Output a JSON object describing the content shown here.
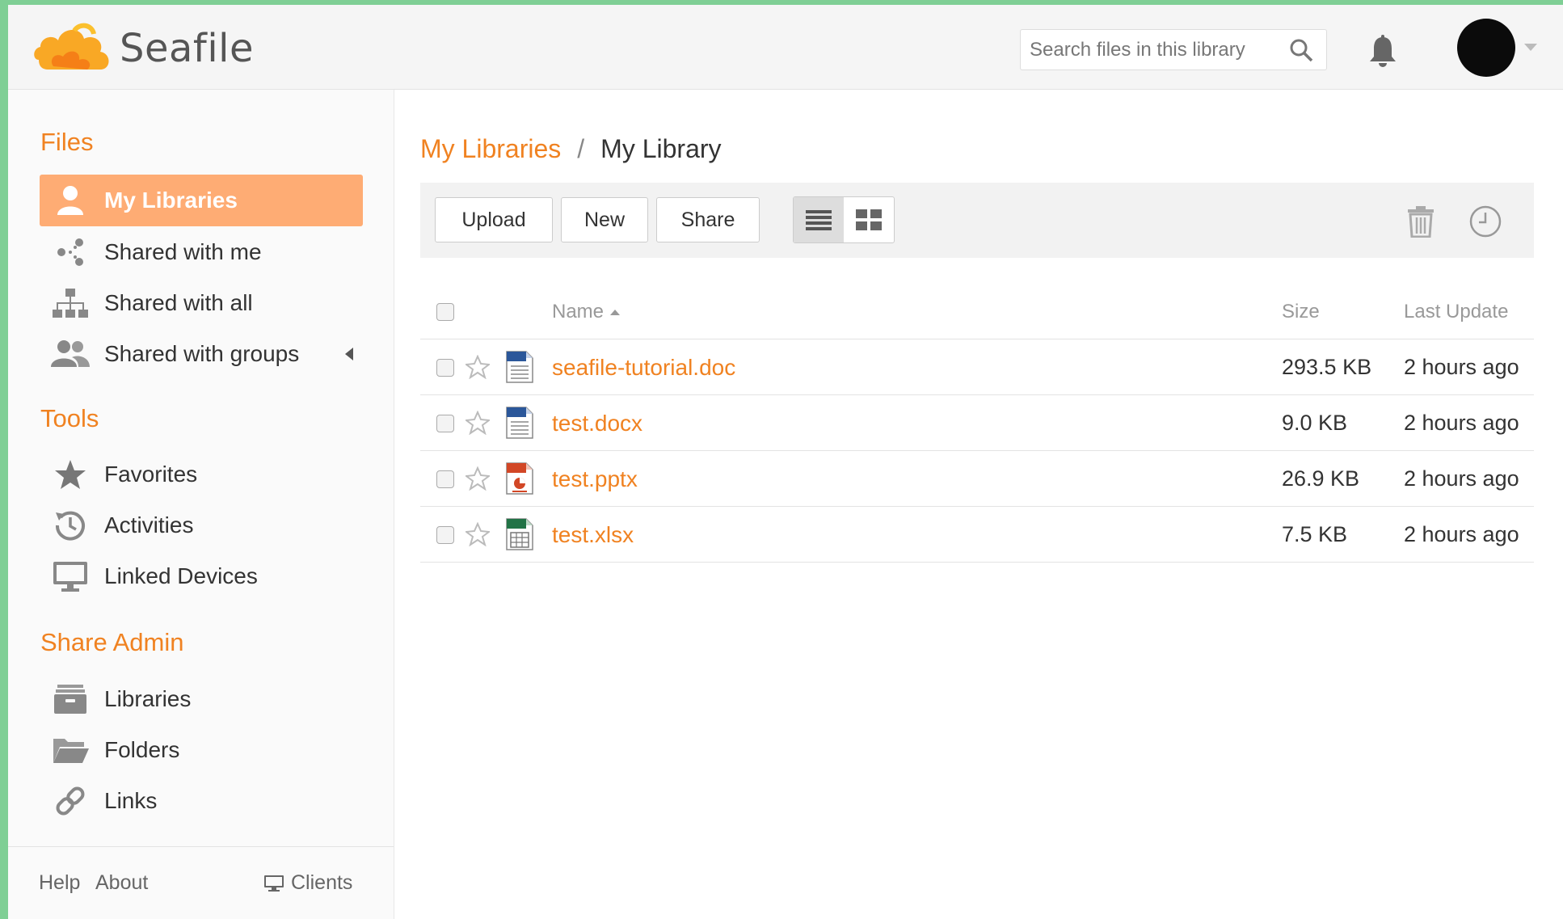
{
  "app": {
    "name": "Seafile"
  },
  "search": {
    "placeholder": "Search files in this library",
    "value": ""
  },
  "sidebar": {
    "files_title": "Files",
    "tools_title": "Tools",
    "share_admin_title": "Share Admin",
    "files_items": [
      {
        "label": "My Libraries",
        "icon": "user-icon",
        "active": true
      },
      {
        "label": "Shared with me",
        "icon": "share-icon"
      },
      {
        "label": "Shared with all",
        "icon": "org-chart-icon"
      },
      {
        "label": "Shared with groups",
        "icon": "group-icon"
      }
    ],
    "tools_items": [
      {
        "label": "Favorites",
        "icon": "star-icon"
      },
      {
        "label": "Activities",
        "icon": "history-icon"
      },
      {
        "label": "Linked Devices",
        "icon": "monitor-icon"
      }
    ],
    "share_admin_items": [
      {
        "label": "Libraries",
        "icon": "archive-icon"
      },
      {
        "label": "Folders",
        "icon": "folder-icon"
      },
      {
        "label": "Links",
        "icon": "link-icon"
      }
    ],
    "footer": {
      "help": "Help",
      "about": "About",
      "clients": "Clients"
    }
  },
  "breadcrumb": {
    "parent": "My Libraries",
    "separator": "/",
    "current": "My Library"
  },
  "toolbar": {
    "upload": "Upload",
    "new": "New",
    "share": "Share"
  },
  "table": {
    "columns": {
      "name": "Name",
      "size": "Size",
      "last_update": "Last Update"
    },
    "rows": [
      {
        "name": "seafile-tutorial.doc",
        "size": "293.5 KB",
        "updated": "2 hours ago",
        "type": "word"
      },
      {
        "name": "test.docx",
        "size": "9.0 KB",
        "updated": "2 hours ago",
        "type": "word"
      },
      {
        "name": "test.pptx",
        "size": "26.9 KB",
        "updated": "2 hours ago",
        "type": "powerpoint"
      },
      {
        "name": "test.xlsx",
        "size": "7.5 KB",
        "updated": "2 hours ago",
        "type": "excel"
      }
    ]
  },
  "colors": {
    "accent": "#f08221",
    "active_bg": "#feac74",
    "frame": "#7fcf95"
  }
}
